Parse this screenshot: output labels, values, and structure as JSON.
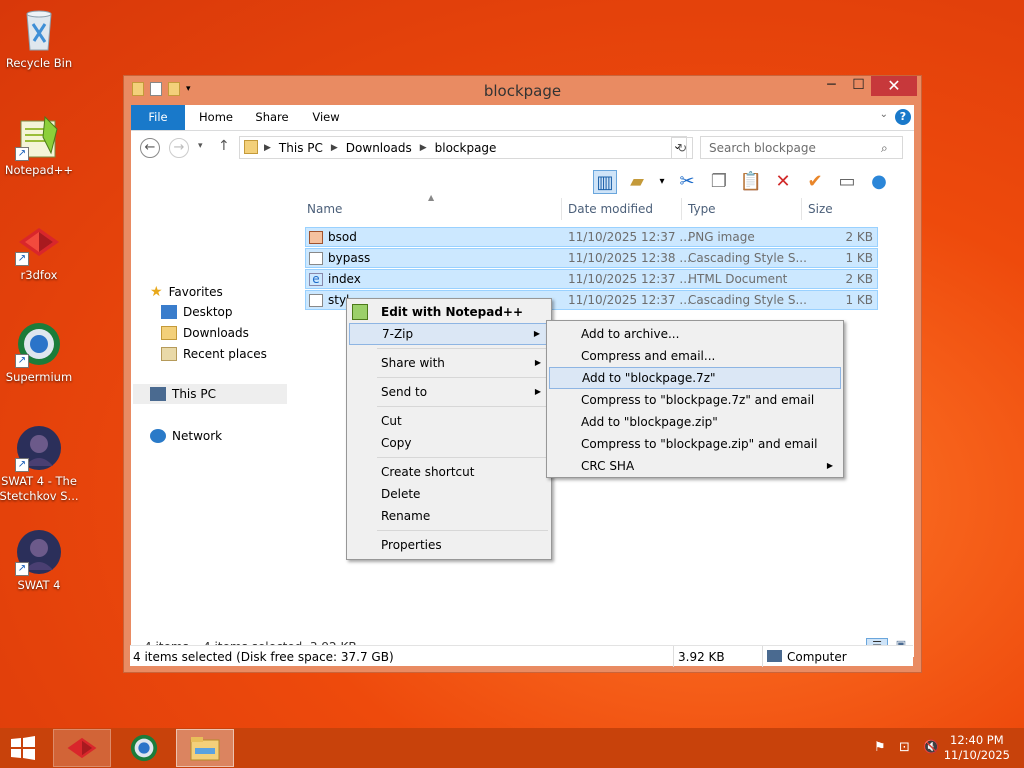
{
  "desktop": {
    "icons": [
      {
        "label": "Recycle Bin"
      },
      {
        "label": "Notepad++"
      },
      {
        "label": "r3dfox"
      },
      {
        "label": "Supermium"
      },
      {
        "label": "SWAT 4 - The Stetchkov S..."
      },
      {
        "label": "SWAT 4"
      }
    ]
  },
  "window": {
    "title": "blockpage",
    "minimize": "─",
    "maximize": "☐",
    "close": "✕",
    "ribbon_tabs": [
      "File",
      "Home",
      "Share",
      "View"
    ],
    "address": {
      "crumbs": [
        "This PC",
        "Downloads",
        "blockpage"
      ],
      "search_placeholder": "Search blockpage"
    },
    "nav": {
      "favorites": "Favorites",
      "desktop": "Desktop",
      "downloads": "Downloads",
      "recent": "Recent places",
      "thispc": "This PC",
      "network": "Network"
    },
    "columns": {
      "name": "Name",
      "date": "Date modified",
      "type": "Type",
      "size": "Size"
    },
    "files": [
      {
        "name": "bsod",
        "date": "11/10/2025 12:37 ...",
        "type": "PNG image",
        "size": "2 KB"
      },
      {
        "name": "bypass",
        "date": "11/10/2025 12:38 ...",
        "type": "Cascading Style S...",
        "size": "1 KB"
      },
      {
        "name": "index",
        "date": "11/10/2025 12:37 ...",
        "type": "HTML Document",
        "size": "2 KB"
      },
      {
        "name": "styl",
        "date": "11/10/2025 12:37 ...",
        "type": "Cascading Style S...",
        "size": "1 KB"
      }
    ],
    "status": {
      "items": "4 items",
      "selected": "4 items selected  3.92 KB"
    },
    "details": {
      "left": "4 items selected (Disk free space: 37.7 GB)",
      "size": "3.92 KB",
      "location": "Computer"
    }
  },
  "context_menu": {
    "items": [
      {
        "label": "Edit with Notepad++"
      },
      {
        "label": "7-Zip"
      },
      {
        "label": "Share with"
      },
      {
        "label": "Send to"
      },
      {
        "label": "Cut"
      },
      {
        "label": "Copy"
      },
      {
        "label": "Create shortcut"
      },
      {
        "label": "Delete"
      },
      {
        "label": "Rename"
      },
      {
        "label": "Properties"
      }
    ]
  },
  "submenu_7zip": {
    "items": [
      {
        "label": "Add to archive..."
      },
      {
        "label": "Compress and email..."
      },
      {
        "label": "Add to \"blockpage.7z\""
      },
      {
        "label": "Compress to \"blockpage.7z\" and email"
      },
      {
        "label": "Add to \"blockpage.zip\""
      },
      {
        "label": "Compress to \"blockpage.zip\" and email"
      },
      {
        "label": "CRC SHA"
      }
    ]
  },
  "taskbar": {
    "time": "12:40 PM",
    "date": "11/10/2025"
  }
}
